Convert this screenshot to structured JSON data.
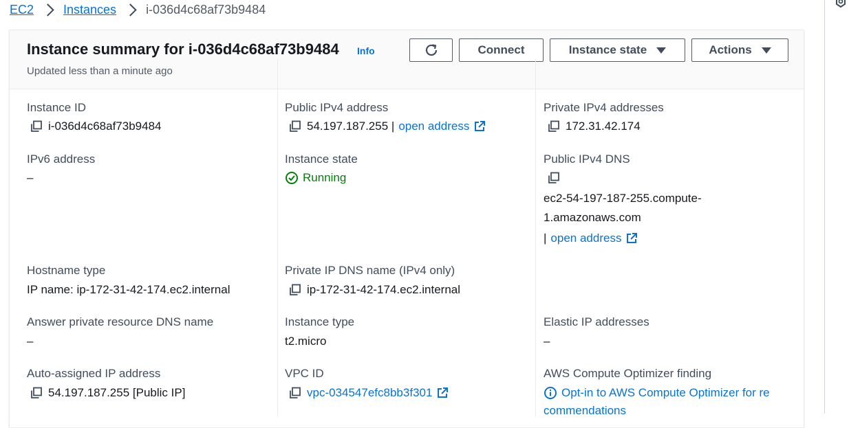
{
  "breadcrumb": {
    "items": [
      "EC2",
      "Instances"
    ],
    "current": "i-036d4c68af73b9484"
  },
  "header": {
    "title": "Instance summary for i-036d4c68af73b9484",
    "info_label": "Info",
    "updated_text": "Updated less than a minute ago",
    "connect_label": "Connect",
    "instance_state_label": "Instance state",
    "actions_label": "Actions"
  },
  "fields": {
    "instance_id": {
      "label": "Instance ID",
      "value": "i-036d4c68af73b9484"
    },
    "public_ipv4": {
      "label": "Public IPv4 address",
      "value": "54.197.187.255",
      "separator": " |",
      "link": "open address"
    },
    "private_ipv4": {
      "label": "Private IPv4 addresses",
      "value": "172.31.42.174"
    },
    "ipv6": {
      "label": "IPv6 address",
      "value": "–"
    },
    "instance_state": {
      "label": "Instance state",
      "value": "Running"
    },
    "public_dns": {
      "label": "Public IPv4 DNS",
      "value_line1": "ec2-54-197-187-255.compute-",
      "value_line2": "1.amazonaws.com",
      "separator": "|",
      "link": "open address"
    },
    "hostname_type": {
      "label": "Hostname type",
      "value": "IP name: ip-172-31-42-174.ec2.internal"
    },
    "private_dns": {
      "label": "Private IP DNS name (IPv4 only)",
      "value": "ip-172-31-42-174.ec2.internal"
    },
    "answer_dns": {
      "label": "Answer private resource DNS name",
      "value": "–"
    },
    "instance_type": {
      "label": "Instance type",
      "value": "t2.micro"
    },
    "elastic_ip": {
      "label": "Elastic IP addresses",
      "value": "–"
    },
    "auto_ip": {
      "label": "Auto-assigned IP address",
      "value": "54.197.187.255 [Public IP]"
    },
    "vpc_id": {
      "label": "VPC ID",
      "value": "vpc-034547efc8bb3f301"
    },
    "optimizer": {
      "label": "AWS Compute Optimizer finding",
      "link_line1": "Opt-in to AWS Compute Optimizer for re",
      "link_line2": "commendations"
    }
  },
  "colors": {
    "link": "#0972d3",
    "success": "#037f0c",
    "text": "#16191f",
    "label": "#414d5c"
  },
  "icons": [
    "copy-icon",
    "external-link-icon",
    "refresh-icon",
    "status-running-icon",
    "info-circle-icon",
    "caret-down-icon"
  ]
}
